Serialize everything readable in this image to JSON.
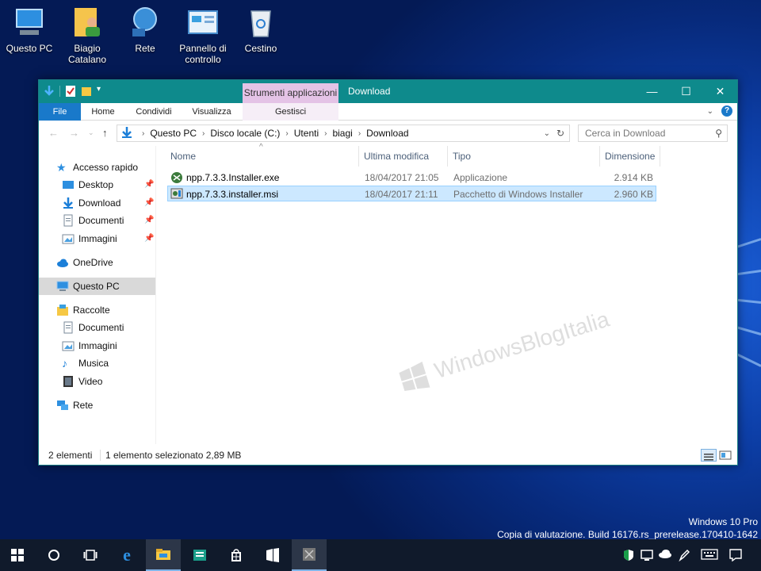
{
  "desktop": {
    "icons": [
      {
        "label": "Questo PC",
        "icon": "computer-icon"
      },
      {
        "label": "Biagio Catalano",
        "icon": "user-folder-icon"
      },
      {
        "label": "Rete",
        "icon": "network-icon"
      },
      {
        "label": "Pannello di controllo",
        "icon": "control-panel-icon"
      },
      {
        "label": "Cestino",
        "icon": "recycle-bin-icon"
      }
    ]
  },
  "window": {
    "title": "Download",
    "context_tab": "Strumenti applicazioni",
    "accent": "#0e8a8c",
    "ribbon_tabs": [
      "File",
      "Home",
      "Condividi",
      "Visualizza",
      "Gestisci"
    ],
    "breadcrumb": [
      "Questo PC",
      "Disco locale (C:)",
      "Utenti",
      "biagi",
      "Download"
    ],
    "search_placeholder": "Cerca in Download",
    "nav": {
      "quick_access": "Accesso rapido",
      "quick_items": [
        "Desktop",
        "Download",
        "Documenti",
        "Immagini"
      ],
      "onedrive": "OneDrive",
      "this_pc": "Questo PC",
      "libraries": "Raccolte",
      "library_items": [
        "Documenti",
        "Immagini",
        "Musica",
        "Video"
      ],
      "network": "Rete"
    },
    "columns": [
      "Nome",
      "Ultima modifica",
      "Tipo",
      "Dimensione"
    ],
    "files": [
      {
        "name": "npp.7.3.3.Installer.exe",
        "modified": "18/04/2017 21:05",
        "type": "Applicazione",
        "size": "2.914 KB"
      },
      {
        "name": "npp.7.3.3.installer.msi",
        "modified": "18/04/2017 21:11",
        "type": "Pacchetto di Windows Installer",
        "size": "2.960 KB"
      }
    ],
    "status": {
      "count": "2 elementi",
      "selection": "1 elemento selezionato  2,89 MB"
    },
    "watermark": "WindowsBlogItalia"
  },
  "os_watermark": {
    "line1": "Windows 10 Pro",
    "line2": "Copia di valutazione. Build 16176.rs_prerelease.170410-1642"
  },
  "taskbar": {
    "items": [
      "start-icon",
      "search-icon",
      "task-view-icon",
      "edge-icon",
      "file-explorer-icon",
      "store-app-icon",
      "store-icon",
      "app-icon",
      "app-icon"
    ]
  }
}
